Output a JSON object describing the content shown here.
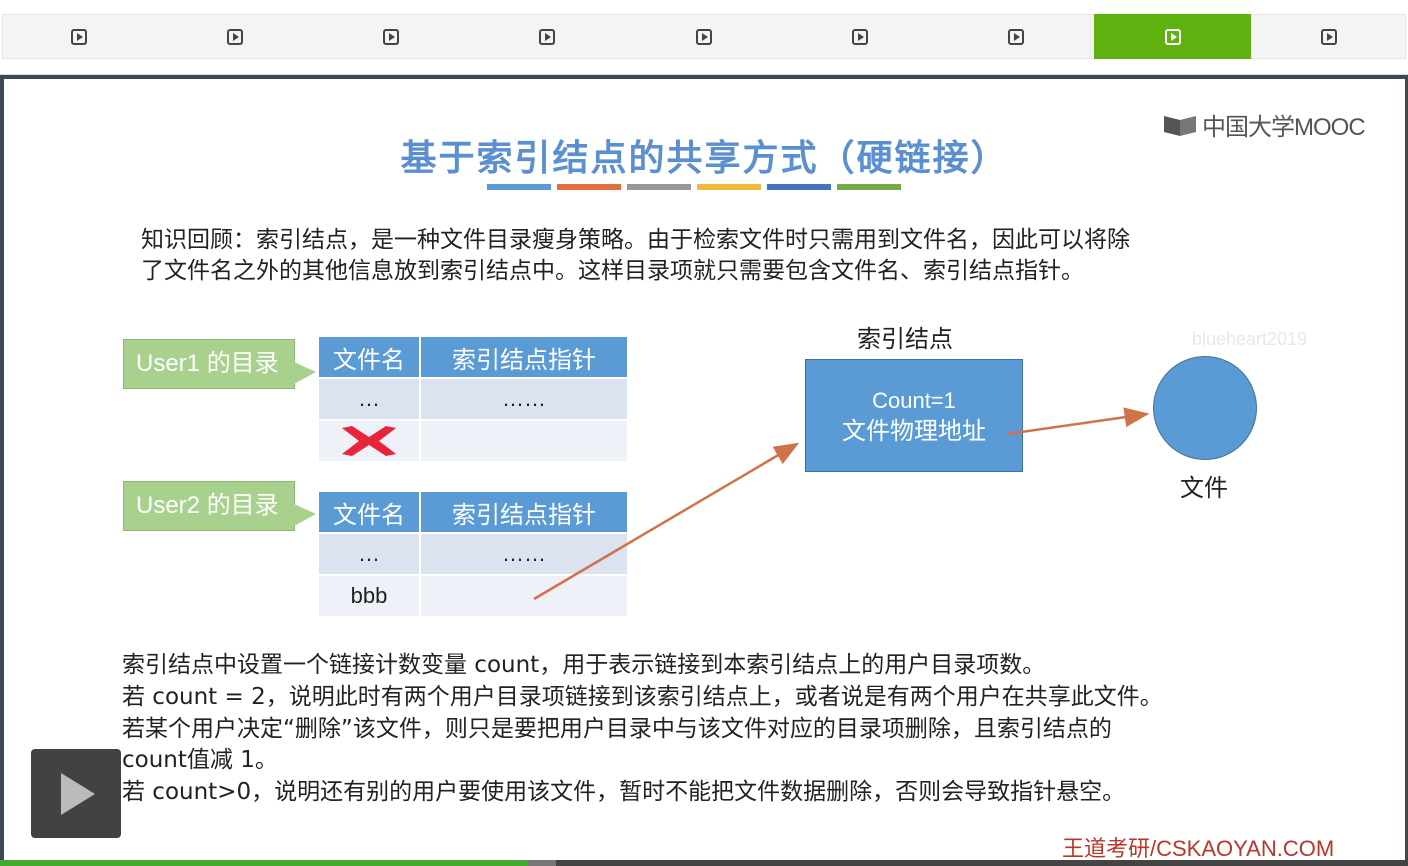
{
  "nav": {
    "items": [
      {
        "icon": "play-square-icon",
        "active": false
      },
      {
        "icon": "play-square-icon",
        "active": false
      },
      {
        "icon": "play-square-icon",
        "active": false
      },
      {
        "icon": "play-square-icon",
        "active": false
      },
      {
        "icon": "play-square-icon",
        "active": false
      },
      {
        "icon": "play-square-icon",
        "active": false
      },
      {
        "icon": "play-square-icon",
        "active": false
      },
      {
        "icon": "play-square-icon",
        "active": true
      },
      {
        "icon": "play-square-icon",
        "active": false
      }
    ],
    "active_color": "#5fb10f"
  },
  "slide": {
    "logo_text": "中国大学MOOC",
    "title": "基于索引结点的共享方式（硬链接）",
    "title_bar_colors": [
      "#5b9bd5",
      "#e0703c",
      "#999999",
      "#f0b93a",
      "#4472c4",
      "#70ad47"
    ],
    "intro_line1": "知识回顾：索引结点，是一种文件目录瘦身策略。由于检索文件时只需用到文件名，因此可以将除",
    "intro_line2": "了文件名之外的其他信息放到索引结点中。这样目录项就只需要包含文件名、索引结点指针。",
    "watermark": "blueheart2019",
    "user1_label": "User1 的目录",
    "user2_label": "User2 的目录",
    "table_headers": {
      "name": "文件名",
      "pointer": "索引结点指针"
    },
    "user1_rows": [
      {
        "name": "…",
        "pointer": "……"
      },
      {
        "name": "",
        "pointer": ""
      }
    ],
    "user2_rows": [
      {
        "name": "…",
        "pointer": "……"
      },
      {
        "name": "bbb",
        "pointer": ""
      }
    ],
    "deleted_mark_icon": "red-x-icon",
    "inode_label": "索引结点",
    "inode_line1": "Count=1",
    "inode_line2": "文件物理地址",
    "file_label": "文件",
    "notes": [
      "索引结点中设置一个链接计数变量 count，用于表示链接到本索引结点上的用户目录项数。",
      "若 count = 2，说明此时有两个用户目录项链接到该索引结点上，或者说是有两个用户在共享此文件。",
      "若某个用户决定“删除”该文件，则只是要把用户目录中与该文件对应的目录项删除，且索引结点的",
      "count值减 1。",
      "若 count>0，说明还有别的用户要使用该文件，暂时不能把文件数据删除，否则会导致指针悬空。"
    ],
    "footer_brand": "王道考研/CSKAOYAN.COM",
    "arrow_color": "#d0734a",
    "box_color": "#5b9bd5",
    "callout_color": "#a9d18e"
  },
  "player": {
    "play_icon": "play-icon",
    "progress": 0.375,
    "buffered": 0.395
  }
}
